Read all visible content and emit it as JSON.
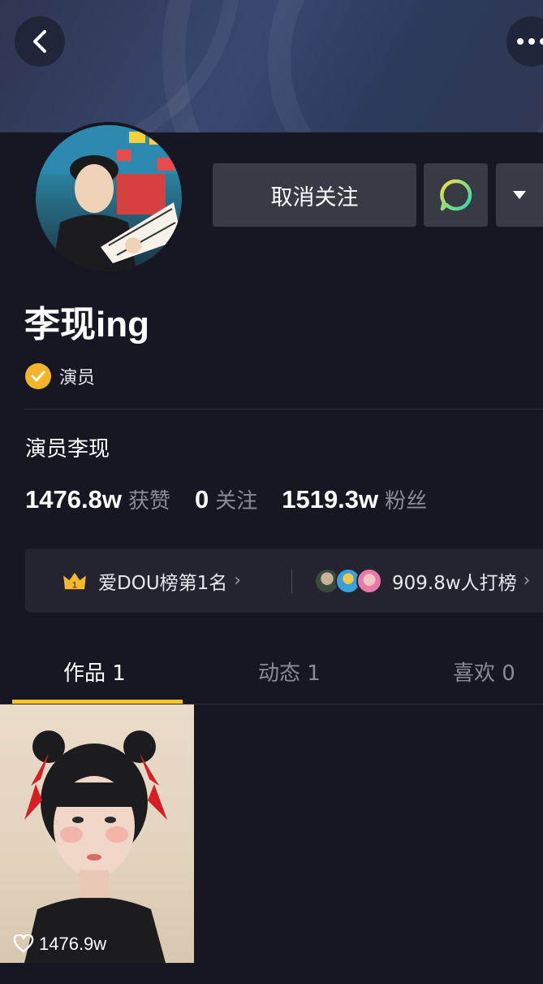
{
  "header": {
    "back_icon": "back-arrow-icon",
    "more_icon": "more-dots-icon"
  },
  "profile": {
    "name": "李现ing",
    "verified_label": "演员",
    "bio": "演员李现",
    "follow_button": "取消关注",
    "message_icon": "chat-bubble-icon",
    "dropdown_icon": "caret-down-icon"
  },
  "stats": [
    {
      "value": "1476.8w",
      "label": "获赞"
    },
    {
      "value": "0",
      "label": "关注"
    },
    {
      "value": "1519.3w",
      "label": "粉丝"
    }
  ],
  "rank": {
    "left_text": "爱DOU榜第1名",
    "crown_badge": "1",
    "right_text": "909.8w人打榜"
  },
  "tabs": [
    {
      "label": "作品 1",
      "active": true
    },
    {
      "label": "动态 1",
      "active": false
    },
    {
      "label": "喜欢 0",
      "active": false
    }
  ],
  "works": [
    {
      "likes": "1476.9w"
    }
  ],
  "colors": {
    "background": "#161723",
    "accent": "#fec52b",
    "verified": "#f5b52a",
    "message_ring": "#3ddc84"
  }
}
